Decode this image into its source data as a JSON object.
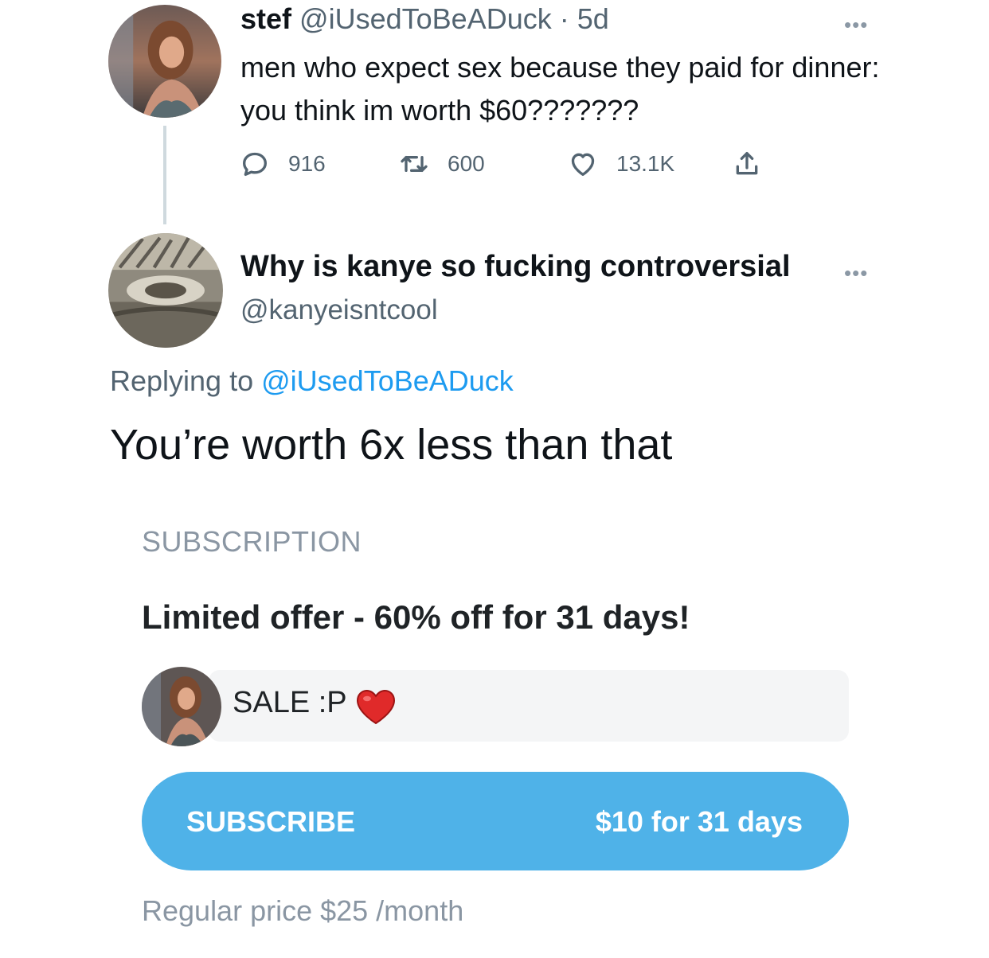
{
  "tweet1": {
    "name": "stef",
    "handle": "@iUsedToBeADuck",
    "time": "· 5d",
    "text": "men who expect sex because they paid for dinner: you think im worth $60???????",
    "replies": "916",
    "retweets": "600",
    "likes": "13.1K",
    "more": "•••"
  },
  "tweet2": {
    "name": "Why is kanye so fucking controversial",
    "handle": "@kanyeisntcool",
    "replying_prefix": "Replying to ",
    "replying_to": "@iUsedToBeADuck",
    "text": "You’re worth 6x less than that",
    "more": "•••"
  },
  "subscription": {
    "section_label": "SUBSCRIPTION",
    "offer": "Limited offer - 60% off for 31 days!",
    "message": "SALE :P",
    "button_label": "SUBSCRIBE",
    "button_price": "$10 for 31 days",
    "regular_price": "Regular price $25 /month"
  },
  "icons": {
    "reply": "reply-icon",
    "retweet": "retweet-icon",
    "like": "heart-icon",
    "share": "share-icon",
    "emoji": "red-heart-emoji"
  },
  "colors": {
    "link": "#1d9bf0",
    "button": "#4fb2e8",
    "muted": "#536471"
  }
}
